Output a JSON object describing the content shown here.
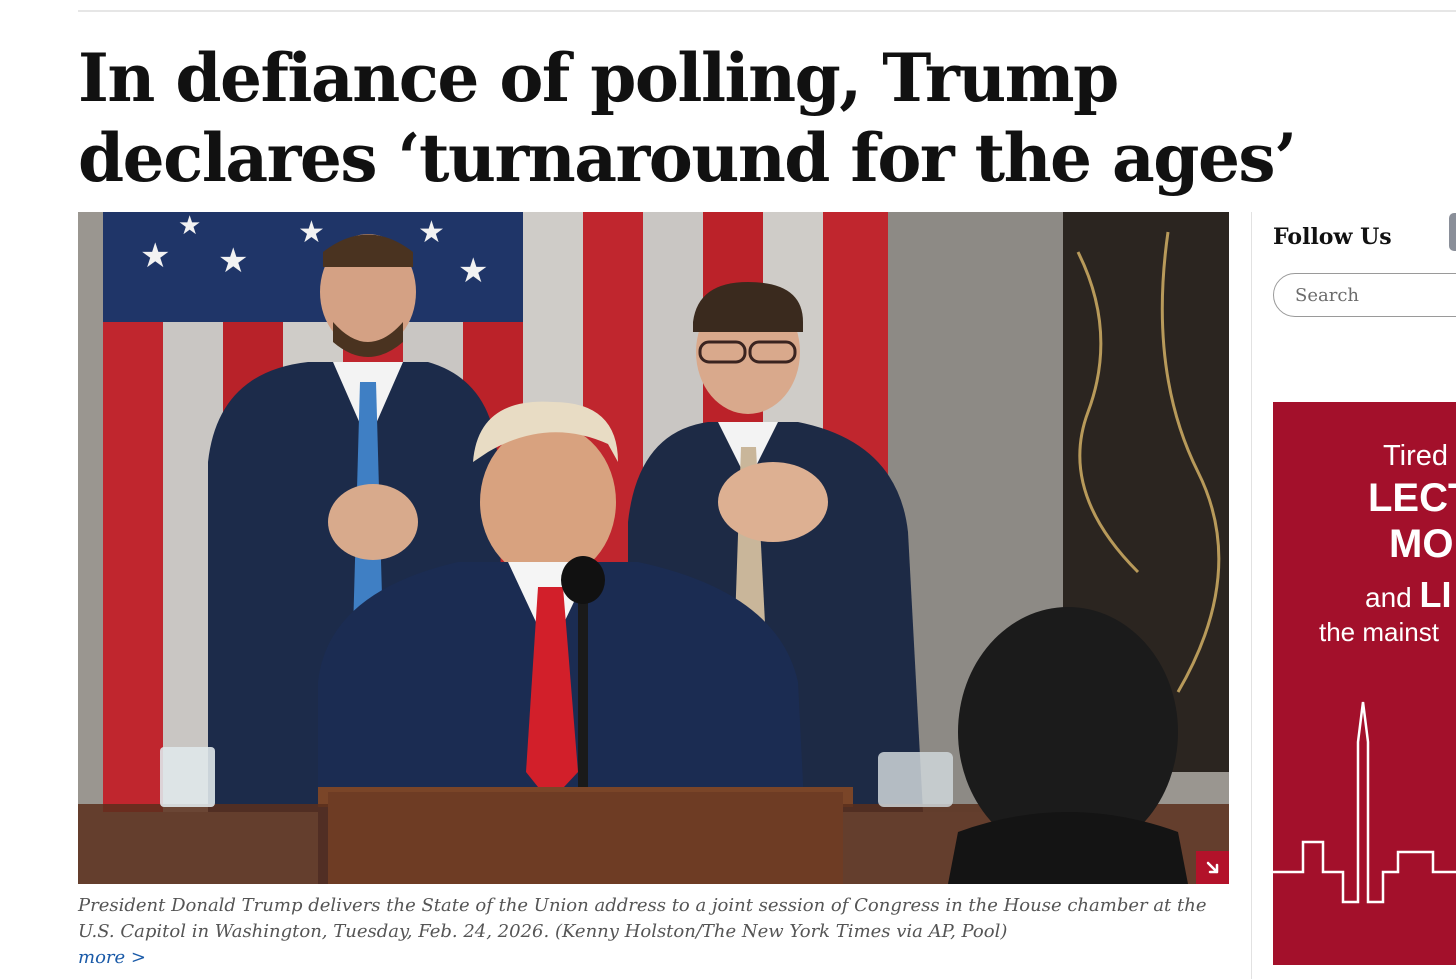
{
  "article": {
    "headline": "In defiance of polling, Trump declares ‘turnaround for the ages’",
    "photo_caption": "President Donald Trump delivers the State of the Union address to a joint session of Congress in the House chamber at the U.S. Capitol in Washington, Tuesday, Feb. 24, 2026. (Kenny Holston/The New York Times via AP, Pool)",
    "more_link": "more >"
  },
  "sidebar": {
    "follow_us": "Follow Us",
    "search_placeholder": "Search",
    "ad": {
      "line1": "Tired",
      "line2": "LECT",
      "line3": "MO",
      "line4_prefix": "and",
      "line4_bold": "LI",
      "line5": "the mainst"
    }
  },
  "icons": {
    "expand": "expand-arrow-icon",
    "social": "social-icon"
  },
  "colors": {
    "link": "#1a5aa8",
    "ad_background": "#a3102b",
    "expand_button": "#b3122a"
  }
}
